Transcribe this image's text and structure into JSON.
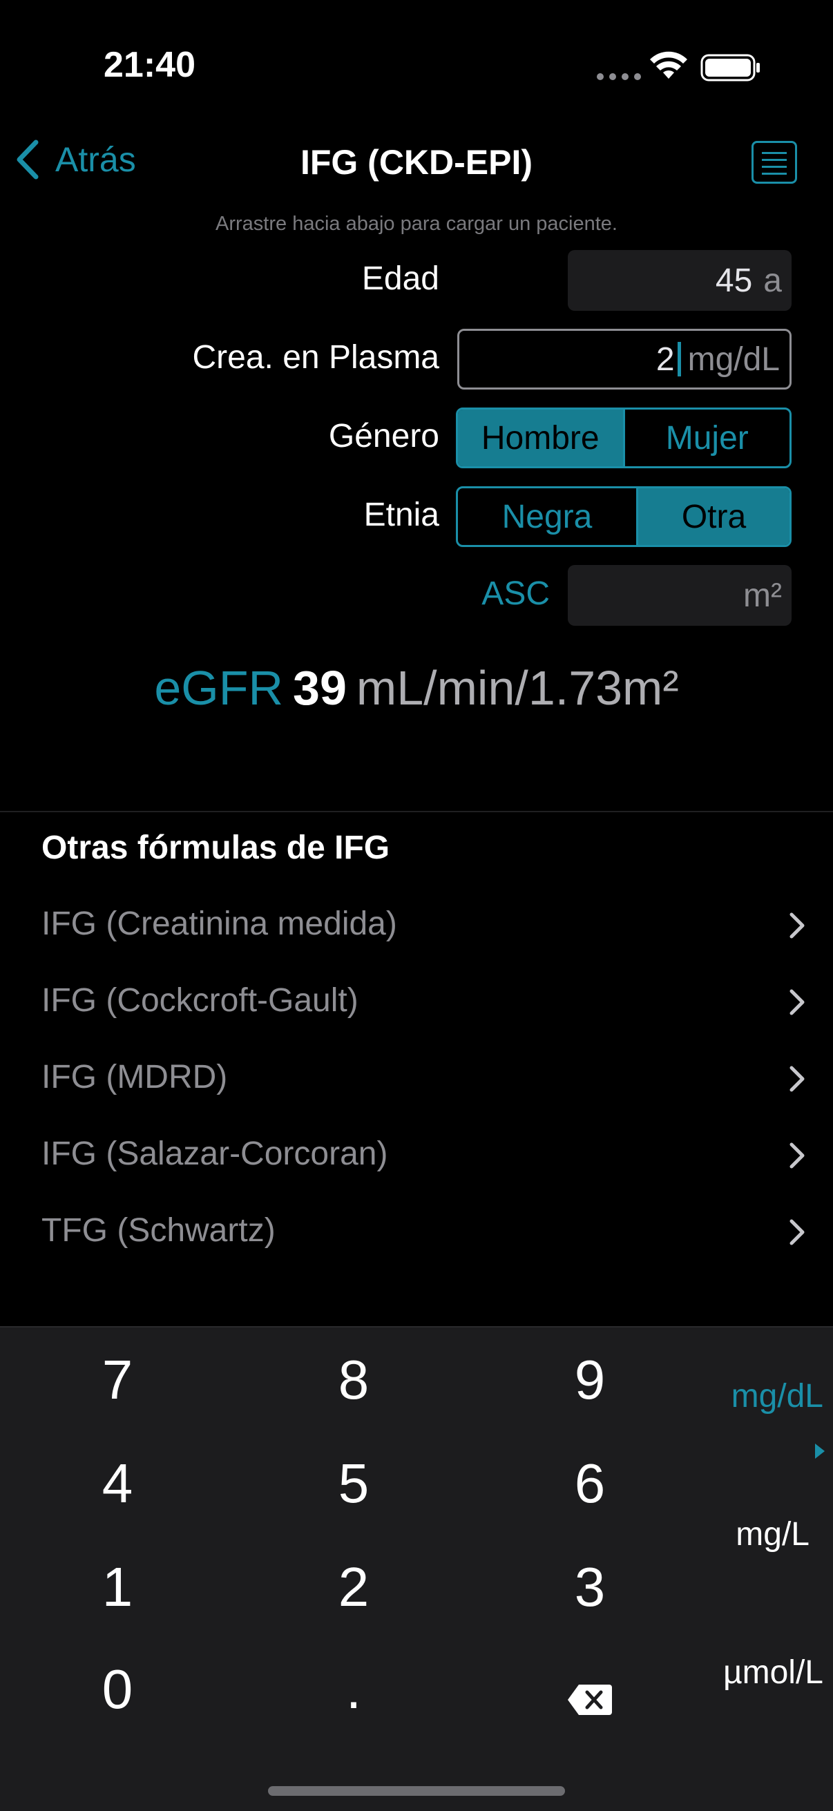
{
  "status": {
    "time": "21:40"
  },
  "nav": {
    "back_label": "Atrás",
    "title": "IFG (CKD-EPI)"
  },
  "hint": "Arrastre hacia abajo para cargar un paciente.",
  "form": {
    "age": {
      "label": "Edad",
      "value": "45",
      "unit": "a"
    },
    "creatinine": {
      "label": "Crea. en Plasma",
      "value": "2",
      "unit": "mg/dL"
    },
    "gender": {
      "label": "Género",
      "options": [
        "Hombre",
        "Mujer"
      ],
      "selected": "Hombre"
    },
    "ethnicity": {
      "label": "Etnia",
      "options": [
        "Negra",
        "Otra"
      ],
      "selected": "Otra"
    },
    "bsa": {
      "label": "ASC",
      "value": "",
      "unit": "m²"
    }
  },
  "result": {
    "label": "eGFR",
    "value": "39",
    "unit": "mL/min/1.73m²"
  },
  "other_formulas": {
    "title": "Otras fórmulas de IFG",
    "items": [
      "IFG (Creatinina medida)",
      "IFG (Cockcroft-Gault)",
      "IFG (MDRD)",
      "IFG (Salazar-Corcoran)",
      "TFG (Schwartz)"
    ]
  },
  "keypad": {
    "keys": [
      "7",
      "8",
      "9",
      "4",
      "5",
      "6",
      "1",
      "2",
      "3",
      "0",
      "."
    ],
    "units": [
      "mg/dL",
      "mg/L",
      "µmol/L"
    ],
    "selected_unit": "mg/dL"
  },
  "colors": {
    "accent": "#1a8fa8",
    "background": "#000000",
    "keypad_bg": "#1c1c1e"
  },
  "icons": [
    "chevron-left-icon",
    "list-icon",
    "chevron-right-icon",
    "backspace-icon",
    "wifi-icon",
    "battery-icon"
  ]
}
